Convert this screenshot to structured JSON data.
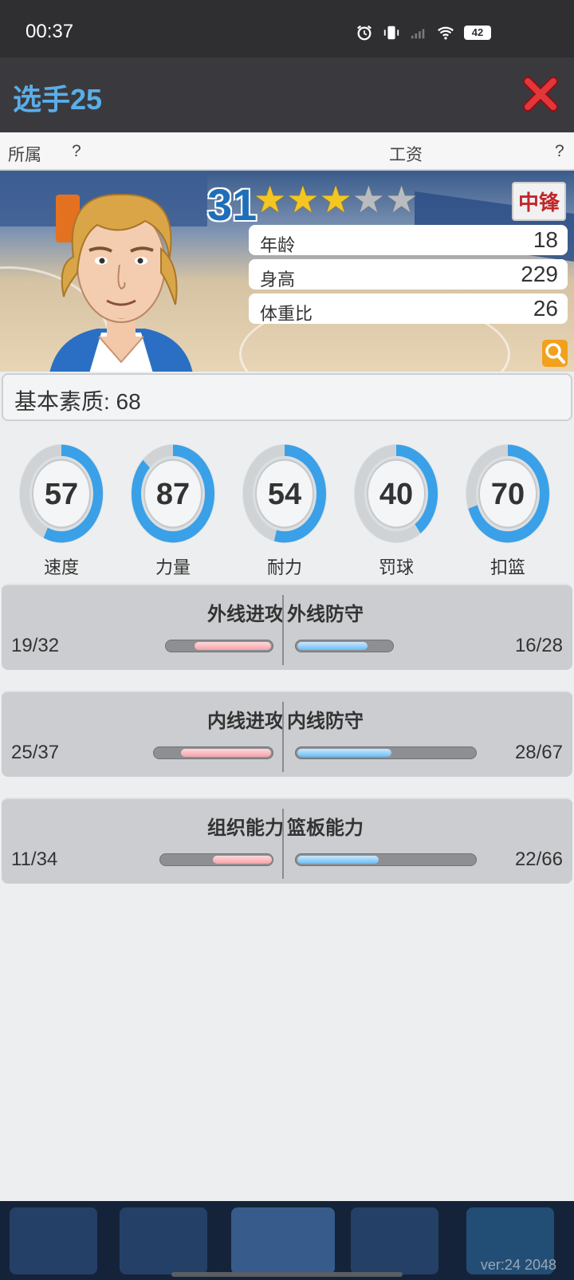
{
  "status": {
    "time": "00:37",
    "battery": "42"
  },
  "header": {
    "title": "选手25"
  },
  "affiliation": {
    "label": "所属",
    "value": "?",
    "salary_label": "工资",
    "salary_value": "?"
  },
  "player": {
    "rating": "31",
    "stars_filled": 3,
    "stars_total": 5,
    "position": "中锋",
    "info": [
      {
        "label": "年龄",
        "value": "18"
      },
      {
        "label": "身高",
        "value": "229"
      },
      {
        "label": "体重比",
        "value": "26"
      }
    ]
  },
  "basic_quality": {
    "label": "基本素质: 68"
  },
  "gauges": [
    {
      "label": "速度",
      "value": 57
    },
    {
      "label": "力量",
      "value": 87
    },
    {
      "label": "耐力",
      "value": 54
    },
    {
      "label": "罚球",
      "value": 40
    },
    {
      "label": "扣篮",
      "value": 70
    }
  ],
  "abilities": [
    {
      "left_title": "外线进攻",
      "left_value": "19/32",
      "right_title": "外线防守",
      "right_value": "16/28"
    },
    {
      "left_title": "内线进攻",
      "left_value": "25/37",
      "right_title": "内线防守",
      "right_value": "28/67"
    },
    {
      "left_title": "组织能力",
      "left_value": "11/34",
      "right_title": "篮板能力",
      "right_value": "22/66"
    }
  ],
  "footer": {
    "version": "ver:24  2048"
  },
  "colors": {
    "accent_blue": "#3aa0e8",
    "title_blue": "#5aaee8",
    "badge_red": "#c0282b",
    "star_gold": "#f3c623"
  },
  "icons": [
    "alarm-icon",
    "vibrate-icon",
    "signal-icon",
    "wifi-icon",
    "battery-icon",
    "close-icon",
    "magnifier-icon",
    "player-portrait"
  ]
}
